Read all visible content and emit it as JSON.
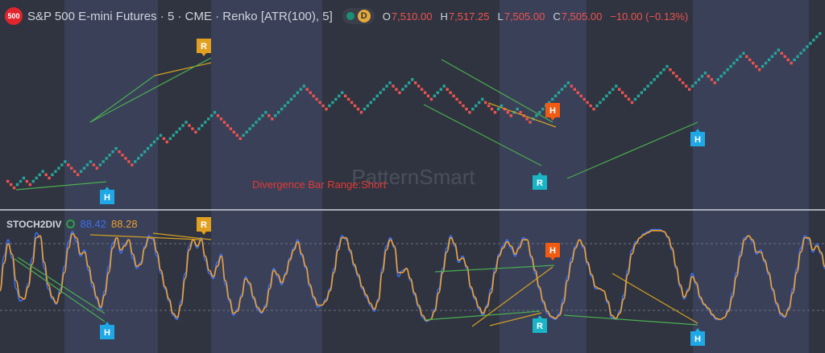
{
  "header": {
    "symbol_badge": "500",
    "title": "S&P 500 E-mini Futures · 5 · CME · Renko [ATR(100), 5]",
    "interval_badge": "D",
    "ohlc": [
      {
        "key": "O",
        "value": "7,510.00"
      },
      {
        "key": "H",
        "value": "7,517.25"
      },
      {
        "key": "L",
        "value": "7,505.00"
      },
      {
        "key": "C",
        "value": "7,505.00"
      }
    ],
    "change": "−10.00 (−0.13%)"
  },
  "watermark": "PatternSmart",
  "annotation": "Divergence Bar Range:Short",
  "indicator": {
    "name": "STOCH2DIV",
    "k_value": "88.42",
    "d_value": "88.28"
  },
  "colors": {
    "up": "#26a69a",
    "down": "#ef5350",
    "k_line": "#3d6ff0",
    "d_line": "#f0a030",
    "div_line": "#4caf50",
    "div_line_alt": "#d4a020",
    "hidden_marker": "#1fa8e6",
    "regular_marker": "#e2a020",
    "h_marker_red": "#f05a12",
    "r_marker_teal": "#19b5c7"
  },
  "chart_data": [
    {
      "type": "renko",
      "path": [
        0,
        -1,
        -1,
        1,
        1,
        1,
        -1,
        -1,
        1,
        1,
        1,
        1,
        -1,
        -1,
        1,
        1,
        1,
        1,
        1,
        -1,
        -1,
        -1,
        -1,
        1,
        1,
        1,
        1,
        -1,
        -1,
        1,
        1,
        1,
        1,
        1,
        1,
        -1,
        -1,
        -1,
        -1,
        -1,
        1,
        1,
        1,
        1,
        1,
        1,
        1,
        1,
        1,
        -1,
        -1,
        1,
        1,
        1,
        1,
        1,
        1,
        -1,
        -1,
        -1,
        1,
        1,
        1,
        1,
        1,
        1,
        -1,
        -1,
        -1,
        -1,
        -1,
        -1,
        -1,
        -1,
        1,
        1,
        1,
        1,
        1,
        1,
        1,
        1,
        -1,
        -1,
        1,
        1,
        1,
        1,
        1,
        1,
        1,
        1,
        1,
        1,
        -1,
        -1,
        -1,
        -1,
        -1,
        -1,
        -1,
        1,
        1,
        1,
        1,
        1,
        -1,
        -1,
        -1,
        -1,
        -1,
        -1,
        1,
        1,
        1,
        1,
        1,
        1,
        1,
        1,
        1,
        -1,
        -1,
        -1,
        1,
        1,
        1,
        1,
        -1,
        -1,
        -1,
        -1,
        -1,
        -1,
        1,
        1,
        1,
        1,
        -1,
        -1,
        -1,
        -1,
        -1,
        -1,
        -1,
        -1,
        1,
        1,
        1,
        1,
        -1,
        -1,
        -1,
        -1,
        1,
        1,
        -1,
        -1,
        -1,
        1,
        1,
        -1,
        -1,
        -1,
        -1,
        1,
        1,
        1,
        1,
        1,
        1,
        1,
        1,
        1,
        1,
        1,
        1,
        -1,
        -1,
        -1,
        -1,
        -1,
        -1,
        -1,
        -1,
        1,
        1,
        1,
        1,
        1,
        1,
        1,
        -1,
        -1,
        -1,
        -1,
        -1,
        1,
        1,
        1,
        1,
        1,
        1,
        1,
        1,
        1,
        1,
        1,
        -1,
        -1,
        -1,
        -1,
        -1,
        -1,
        -1,
        1,
        1,
        1,
        1,
        1,
        -1,
        -1,
        -1,
        1,
        1,
        1,
        1,
        1,
        1,
        1,
        1,
        1,
        -1,
        -1,
        -1,
        -1,
        -1,
        1,
        1,
        1,
        1,
        1,
        1,
        -1,
        -1,
        -1,
        -1,
        1,
        1,
        1,
        1,
        1,
        1,
        1,
        1,
        1
      ]
    },
    {
      "type": "line",
      "title": "STOCH2DIV",
      "ylim": [
        0,
        100
      ],
      "series": [
        {
          "name": "K",
          "values": [
            40,
            72,
            88,
            70,
            40,
            28,
            30,
            45,
            70,
            95,
            90,
            60,
            40,
            30,
            25,
            40,
            62,
            86,
            96,
            86,
            72,
            78,
            58,
            42,
            30,
            20,
            38,
            62,
            85,
            90,
            75,
            84,
            88,
            70,
            60,
            66,
            82,
            92,
            88,
            72,
            55,
            40,
            28,
            14,
            10,
            28,
            55,
            82,
            88,
            80,
            90,
            68,
            55,
            50,
            66,
            74,
            44,
            28,
            14,
            20,
            34,
            52,
            44,
            30,
            20,
            16,
            24,
            44,
            60,
            52,
            44,
            56,
            70,
            80,
            88,
            72,
            60,
            42,
            30,
            22,
            24,
            30,
            40,
            60,
            82,
            92,
            88,
            76,
            62,
            52,
            40,
            32,
            24,
            18,
            30,
            60,
            82,
            90,
            80,
            52,
            58,
            60,
            48,
            34,
            22,
            12,
            8,
            10,
            20,
            40,
            60,
            80,
            92,
            82,
            66,
            72,
            60,
            40,
            30,
            20,
            14,
            24,
            40,
            60,
            74,
            82,
            88,
            80,
            72,
            82,
            90,
            88,
            70,
            55,
            40,
            26,
            16,
            12,
            10,
            16,
            30,
            52,
            70,
            82,
            88,
            80,
            64,
            52,
            40,
            40,
            38,
            26,
            12,
            10,
            18,
            34,
            58,
            78,
            86,
            90,
            94,
            96,
            98,
            98,
            98,
            96,
            90,
            78,
            60,
            42,
            30,
            40,
            55,
            44,
            30,
            24,
            20,
            14,
            10,
            10,
            12,
            20,
            36,
            56,
            76,
            90,
            92,
            86,
            74,
            78,
            66,
            54,
            38,
            24,
            14,
            12,
            22,
            40,
            60,
            80,
            92,
            88,
            76,
            84,
            74,
            60
          ]
        },
        {
          "name": "D",
          "values": [
            38,
            65,
            84,
            74,
            48,
            32,
            30,
            42,
            64,
            90,
            92,
            66,
            44,
            32,
            26,
            36,
            56,
            80,
            94,
            90,
            74,
            76,
            62,
            46,
            32,
            22,
            34,
            56,
            80,
            90,
            78,
            82,
            88,
            74,
            62,
            64,
            80,
            90,
            90,
            76,
            58,
            42,
            30,
            16,
            12,
            24,
            50,
            78,
            88,
            82,
            88,
            72,
            58,
            52,
            62,
            72,
            48,
            30,
            16,
            18,
            32,
            50,
            46,
            32,
            22,
            17,
            22,
            40,
            58,
            54,
            46,
            54,
            68,
            78,
            86,
            74,
            62,
            44,
            32,
            24,
            24,
            28,
            38,
            56,
            78,
            90,
            90,
            78,
            64,
            54,
            42,
            34,
            26,
            20,
            28,
            56,
            78,
            88,
            82,
            56,
            56,
            60,
            50,
            36,
            24,
            14,
            9,
            10,
            18,
            36,
            56,
            76,
            90,
            84,
            68,
            70,
            62,
            42,
            32,
            22,
            16,
            22,
            36,
            56,
            72,
            80,
            86,
            82,
            74,
            80,
            88,
            88,
            72,
            58,
            42,
            28,
            18,
            13,
            11,
            14,
            26,
            48,
            66,
            80,
            88,
            82,
            66,
            54,
            42,
            40,
            38,
            28,
            14,
            11,
            16,
            30,
            54,
            74,
            84,
            90,
            93,
            95,
            97,
            97,
            97,
            96,
            91,
            80,
            62,
            44,
            32,
            38,
            52,
            46,
            32,
            25,
            21,
            15,
            11,
            10,
            12,
            18,
            32,
            52,
            72,
            88,
            92,
            88,
            76,
            76,
            68,
            56,
            40,
            26,
            16,
            13,
            20,
            36,
            56,
            76,
            90,
            90,
            78,
            82,
            76,
            62
          ]
        }
      ]
    }
  ]
}
